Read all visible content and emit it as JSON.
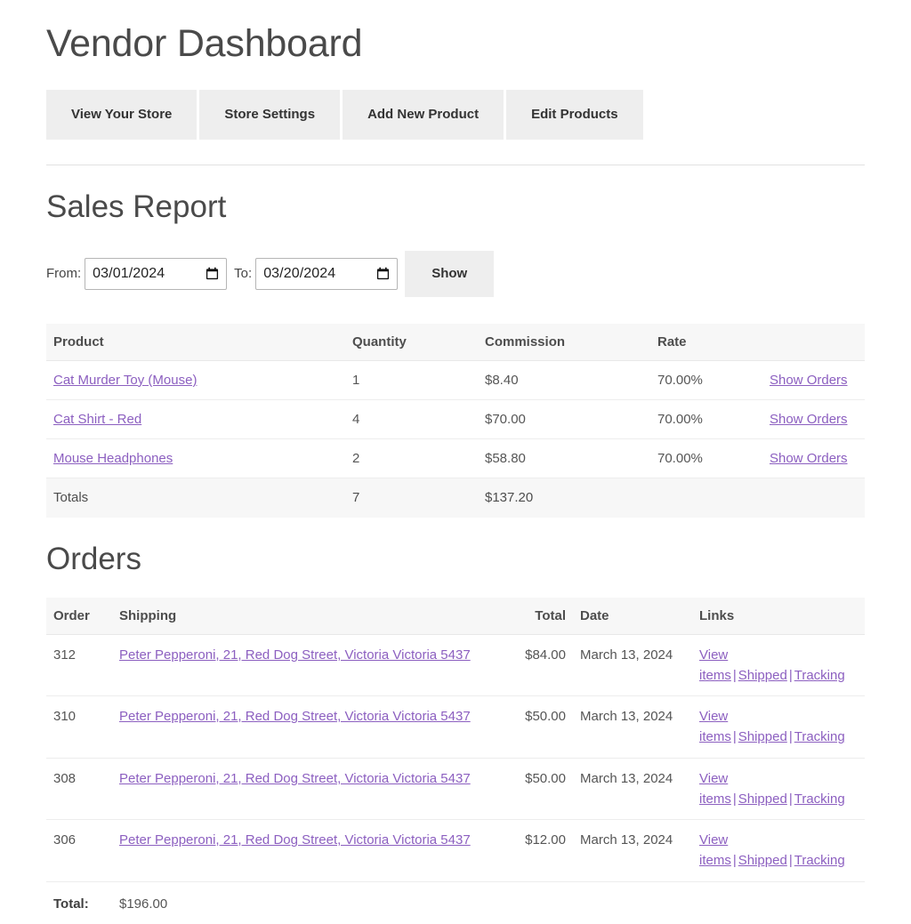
{
  "page": {
    "title": "Vendor Dashboard"
  },
  "nav": {
    "buttons": [
      {
        "label": "View Your Store"
      },
      {
        "label": "Store Settings"
      },
      {
        "label": "Add New Product"
      },
      {
        "label": "Edit Products"
      }
    ]
  },
  "sales_report": {
    "heading": "Sales Report",
    "filter": {
      "from_label": "From:",
      "from_value": "03/01/2024",
      "to_label": "To:",
      "to_value": "03/20/2024",
      "submit_label": "Show",
      "calendar_icon": "calendar-icon"
    },
    "columns": [
      "Product",
      "Quantity",
      "Commission",
      "Rate",
      ""
    ],
    "rows": [
      {
        "product": "Cat Murder Toy (Mouse)",
        "quantity": "1",
        "commission": "$8.40",
        "rate": "70.00%",
        "action": "Show Orders"
      },
      {
        "product": "Cat Shirt - Red",
        "quantity": "4",
        "commission": "$70.00",
        "rate": "70.00%",
        "action": "Show Orders"
      },
      {
        "product": "Mouse Headphones",
        "quantity": "2",
        "commission": "$58.80",
        "rate": "70.00%",
        "action": "Show Orders"
      }
    ],
    "totals": {
      "label": "Totals",
      "quantity": "7",
      "commission": "$137.20",
      "rate": "",
      "action": ""
    }
  },
  "orders": {
    "heading": "Orders",
    "columns": [
      "Order",
      "Shipping",
      "Total",
      "Date",
      "Links"
    ],
    "rows": [
      {
        "order": "312",
        "shipping": "Peter Pepperoni, 21, Red Dog Street, Victoria Victoria 5437",
        "total": "$84.00",
        "date": "March 13, 2024",
        "links": [
          "View items",
          "Shipped",
          "Tracking"
        ]
      },
      {
        "order": "310",
        "shipping": "Peter Pepperoni, 21, Red Dog Street, Victoria Victoria 5437",
        "total": "$50.00",
        "date": "March 13, 2024",
        "links": [
          "View items",
          "Shipped",
          "Tracking"
        ]
      },
      {
        "order": "308",
        "shipping": "Peter Pepperoni, 21, Red Dog Street, Victoria Victoria 5437",
        "total": "$50.00",
        "date": "March 13, 2024",
        "links": [
          "View items",
          "Shipped",
          "Tracking"
        ]
      },
      {
        "order": "306",
        "shipping": "Peter Pepperoni, 21, Red Dog Street, Victoria Victoria 5437",
        "total": "$12.00",
        "date": "March 13, 2024",
        "links": [
          "View items",
          "Shipped",
          "Tracking"
        ]
      }
    ],
    "grand_total": {
      "label": "Total:",
      "value": "$196.00"
    }
  },
  "separator": "|",
  "colors": {
    "link": "#8c5fc0",
    "button_bg": "#eeeeee",
    "header_bg": "#f7f7f7",
    "text": "#333333"
  }
}
